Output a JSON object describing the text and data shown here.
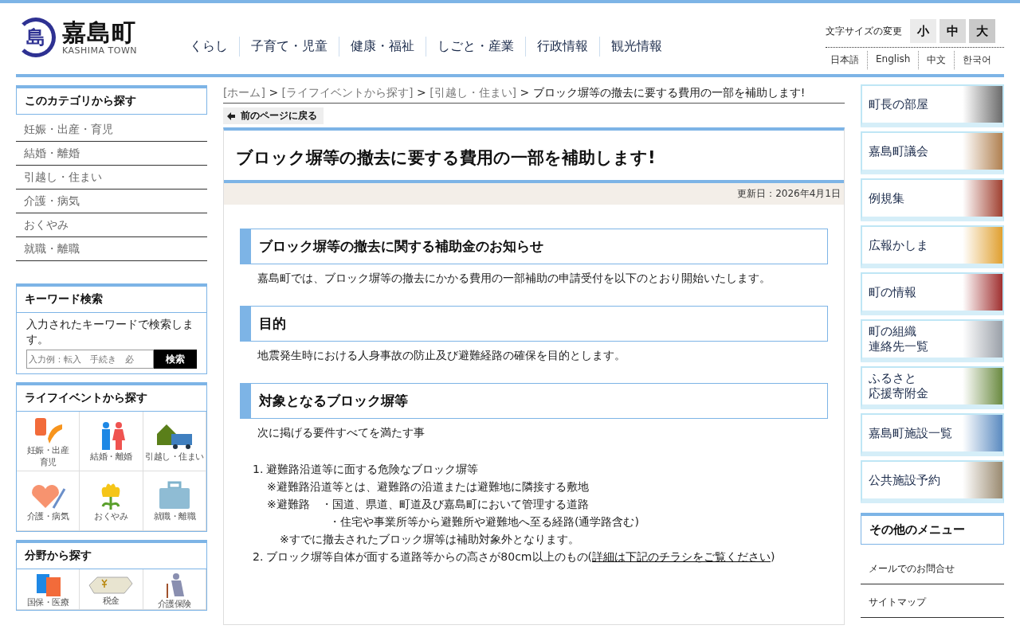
{
  "header": {
    "logo": {
      "emblem": "島",
      "name": "嘉島町",
      "sub": "KASHIMA TOWN"
    },
    "nav": [
      "くらし",
      "子育て・児童",
      "健康・福祉",
      "しごと・産業",
      "行政情報",
      "観光情報"
    ],
    "font_size": {
      "label": "文字サイズの変更",
      "sizes": [
        "小",
        "中",
        "大"
      ]
    },
    "languages": [
      "日本語",
      "English",
      "中文",
      "한국어"
    ]
  },
  "left": {
    "category": {
      "title": "このカテゴリから探す",
      "items": [
        "妊娠・出産・育児",
        "結婚・離婚",
        "引越し・住まい",
        "介護・病気",
        "おくやみ",
        "就職・離職"
      ]
    },
    "keyword": {
      "title": "キーワード検索",
      "text": "入力されたキーワードで検索します。",
      "placeholder": "入力例：転入　手続き　必",
      "button": "検索"
    },
    "life_events": {
      "title": "ライフイベントから探す",
      "items": [
        {
          "lines": [
            "妊娠・出産",
            "育児"
          ]
        },
        {
          "lines": [
            "結婚・離婚"
          ]
        },
        {
          "lines": [
            "引越し・住まい"
          ]
        },
        {
          "lines": [
            "介護・病気"
          ]
        },
        {
          "lines": [
            "おくやみ"
          ]
        },
        {
          "lines": [
            "就職・離職"
          ]
        }
      ]
    },
    "fields": {
      "title": "分野から探す",
      "items": [
        "国保・医療",
        "税金",
        "介護保険"
      ]
    }
  },
  "main": {
    "breadcrumb": [
      {
        "kind": "link",
        "label": "[ホーム]"
      },
      {
        "kind": "separator",
        "label": ">"
      },
      {
        "kind": "link",
        "label": "[ライフイベントから探す]"
      },
      {
        "kind": "separator",
        "label": ">"
      },
      {
        "kind": "link",
        "label": "[引越し・住まい]"
      },
      {
        "kind": "separator",
        "label": ">"
      },
      {
        "kind": "current",
        "label": "ブロック塀等の撤去に要する費用の一部を補助します!"
      }
    ],
    "back": "前のページに戻る",
    "title": "ブロック塀等の撤去に要する費用の一部を補助します!",
    "updated": "更新日：2026年4月1日",
    "blocks": [
      {
        "kind": "heading",
        "text": "ブロック塀等の撤去に関する補助金のお知らせ"
      },
      {
        "kind": "paragraph",
        "text": "嘉島町では、ブロック塀等の撤去にかかる費用の一部補助の申請受付を以下のとおり開始いたします。"
      },
      {
        "kind": "heading",
        "text": "目的"
      },
      {
        "kind": "paragraph",
        "text": "地震発生時における人身事故の防止及び避難経路の確保を目的とします。"
      },
      {
        "kind": "heading",
        "text": "対象となるブロック塀等"
      },
      {
        "kind": "paragraph",
        "text": "次に掲げる要件すべてを満たす事"
      },
      {
        "kind": "list",
        "items": [
          {
            "marker": "1.",
            "text": "避難路沿道等に面する危険なブロック塀等",
            "notes": [
              {
                "kind": "note",
                "text": "※避難路沿道等とは、避難路の沿道または避難地に隣接する敷地"
              },
              {
                "kind": "note",
                "text": "※避難路　・国道、県道、町道及び嘉島町において管理する道路"
              },
              {
                "kind": "continuation",
                "text": "・住宅や事業所等から避難所や避難地へ至る経路(通学路含む)"
              },
              {
                "kind": "remark",
                "text": "※すでに撤去されたブロック塀等は補助対象外となります。"
              }
            ]
          },
          {
            "marker": "2.",
            "text": "ブロック塀等自体が面する道路等からの高さが80cm以上のもの(",
            "link": "詳細は下記のチラシをご覧ください",
            "after": ")"
          }
        ]
      }
    ]
  },
  "right": {
    "banners": [
      {
        "lines": [
          "町長の部屋"
        ]
      },
      {
        "lines": [
          "嘉島町議会"
        ]
      },
      {
        "lines": [
          "例規集"
        ]
      },
      {
        "lines": [
          "広報かしま"
        ]
      },
      {
        "lines": [
          "町の情報"
        ]
      },
      {
        "lines": [
          "町の組織",
          "連絡先一覧"
        ]
      },
      {
        "lines": [
          "ふるさと",
          "応援寄附金"
        ]
      },
      {
        "lines": [
          "嘉島町施設一覧"
        ]
      },
      {
        "lines": [
          "公共施設予約"
        ]
      }
    ],
    "other_menu": {
      "title": "その他のメニュー",
      "items": [
        "メールでのお問合せ",
        "サイトマップ"
      ]
    }
  }
}
